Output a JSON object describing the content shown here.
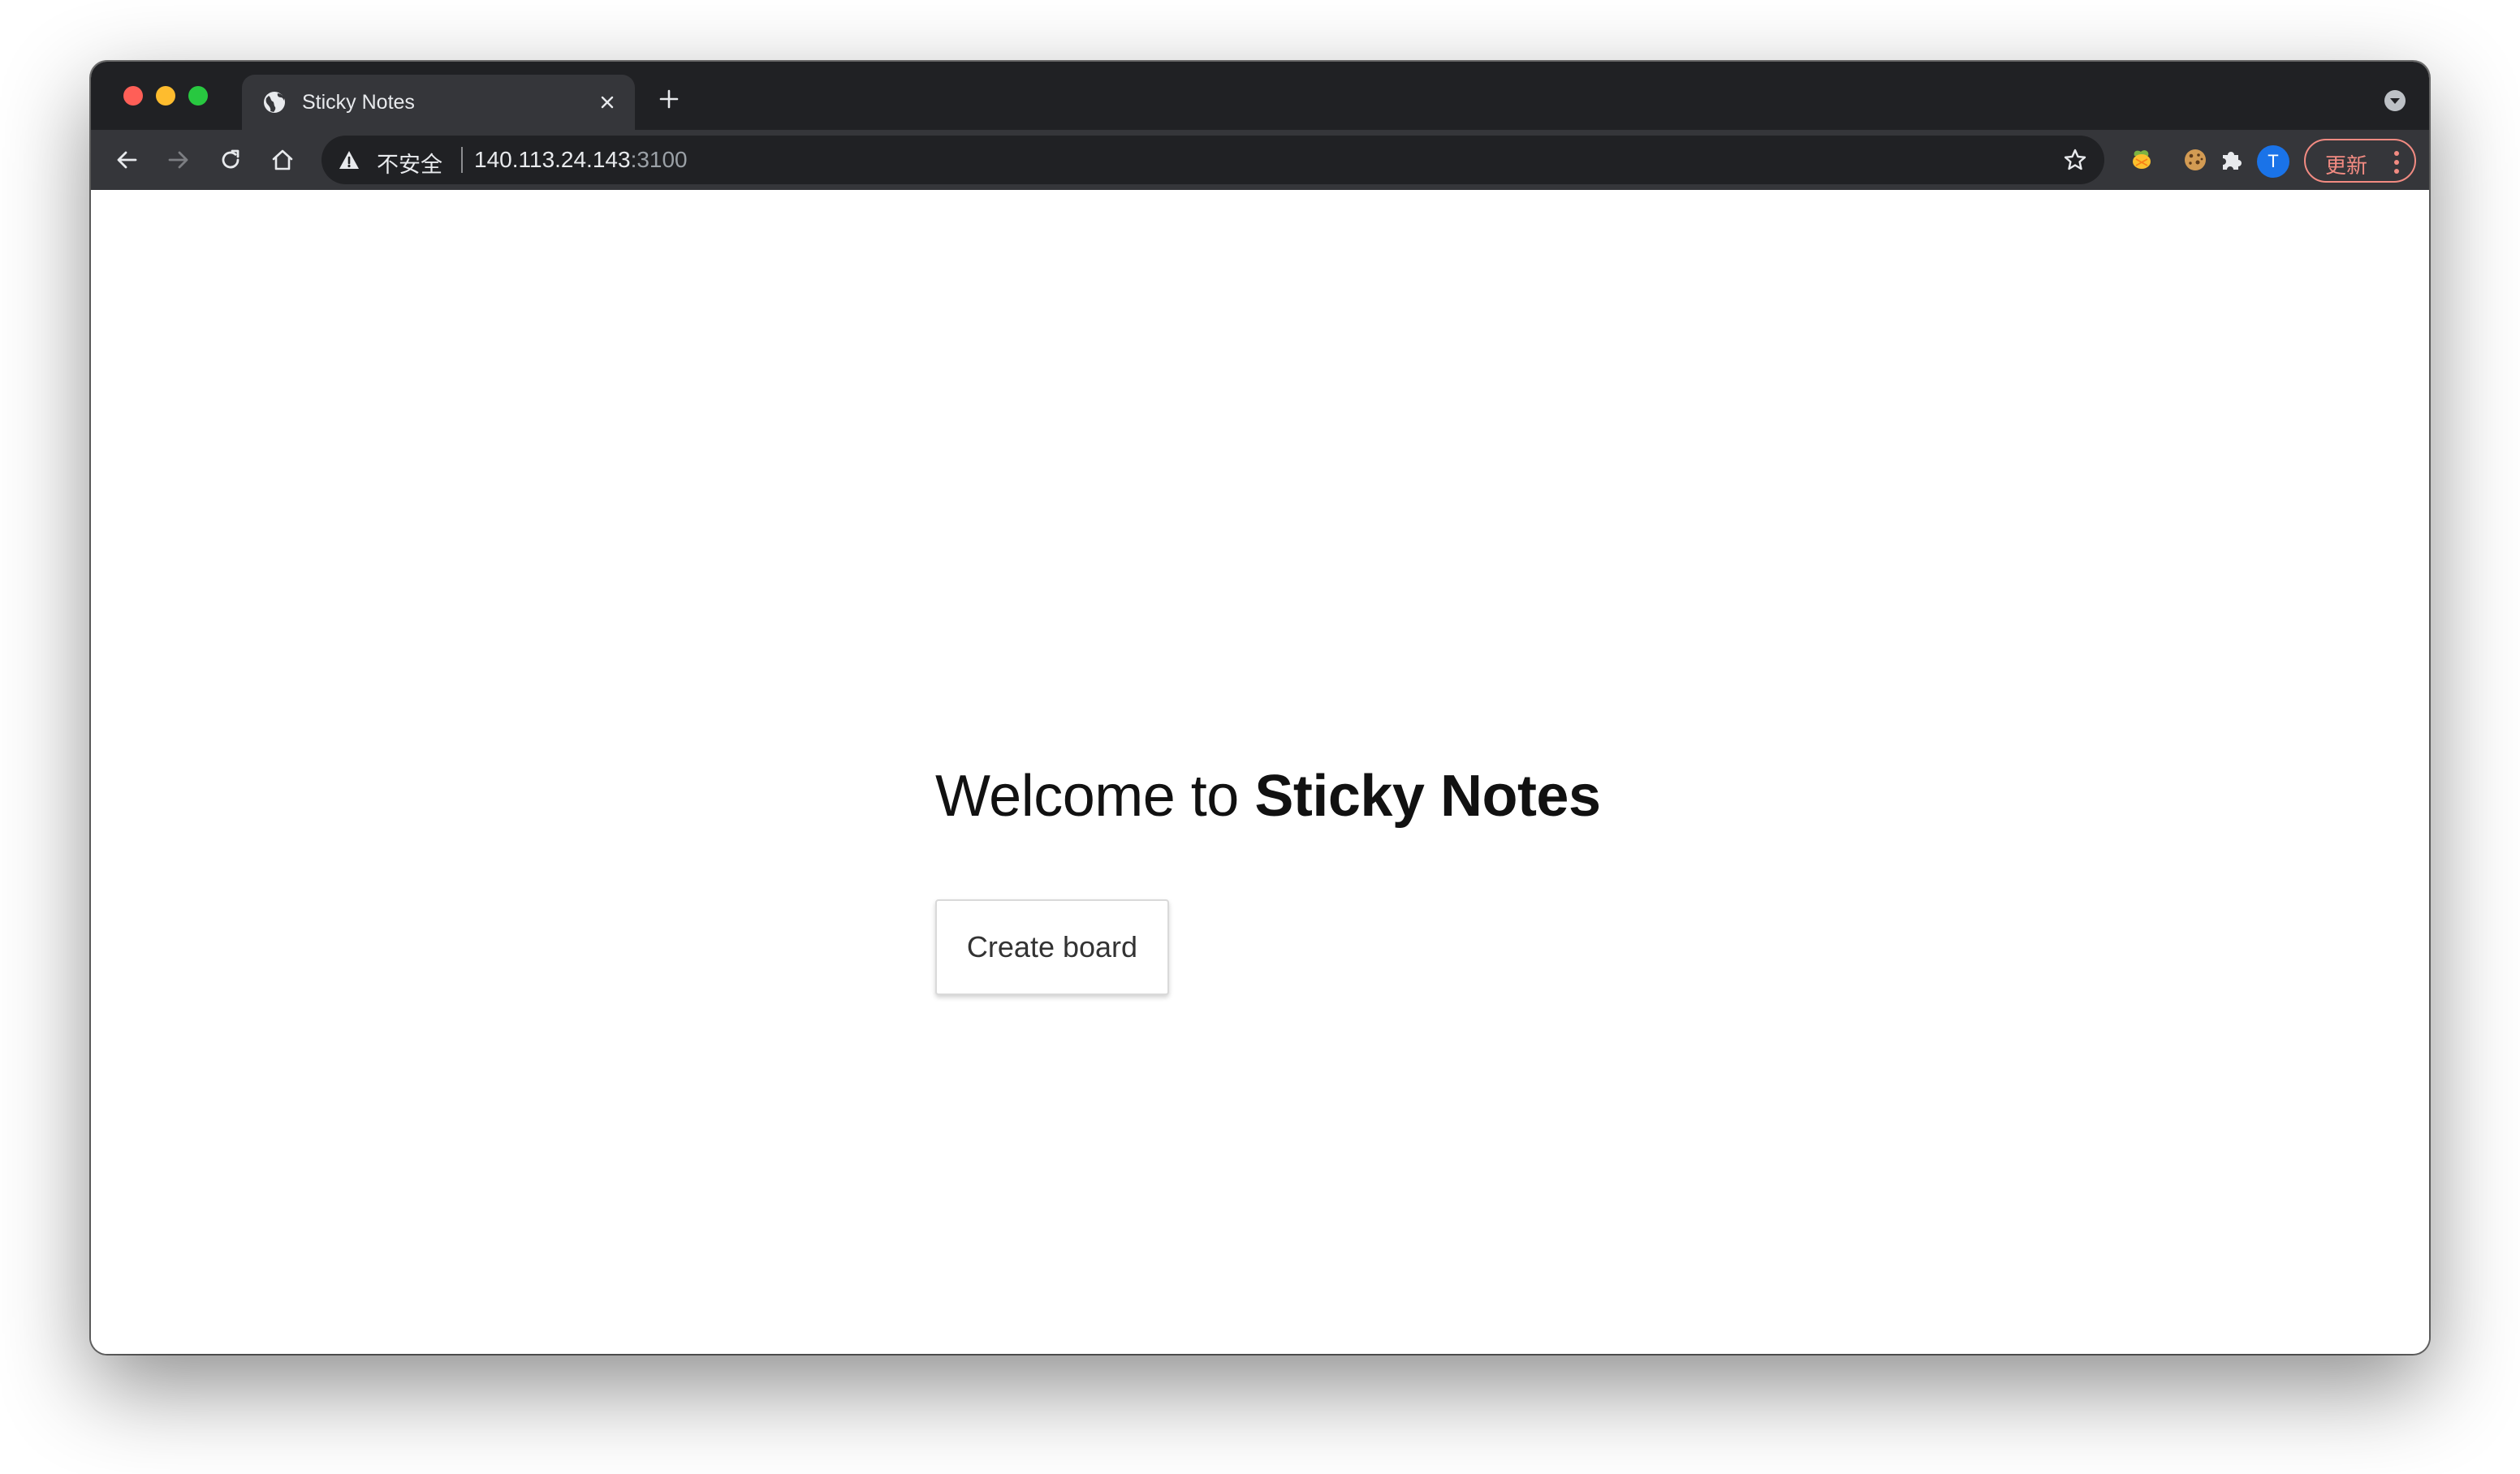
{
  "browser": {
    "tab": {
      "title": "Sticky Notes",
      "favicon": "globe-icon"
    },
    "address_bar": {
      "security_label": "不安全",
      "host": "140.113.24.143",
      "port": ":3100"
    },
    "profile_initial": "T",
    "update_label": "更新",
    "colors": {
      "frame": "#202124",
      "toolbar": "#35363a",
      "update_accent": "#f28b82",
      "avatar": "#1a73e8"
    }
  },
  "page": {
    "heading_prefix": "Welcome to",
    "heading_app_name": "Sticky Notes",
    "create_button_label": "Create board"
  }
}
